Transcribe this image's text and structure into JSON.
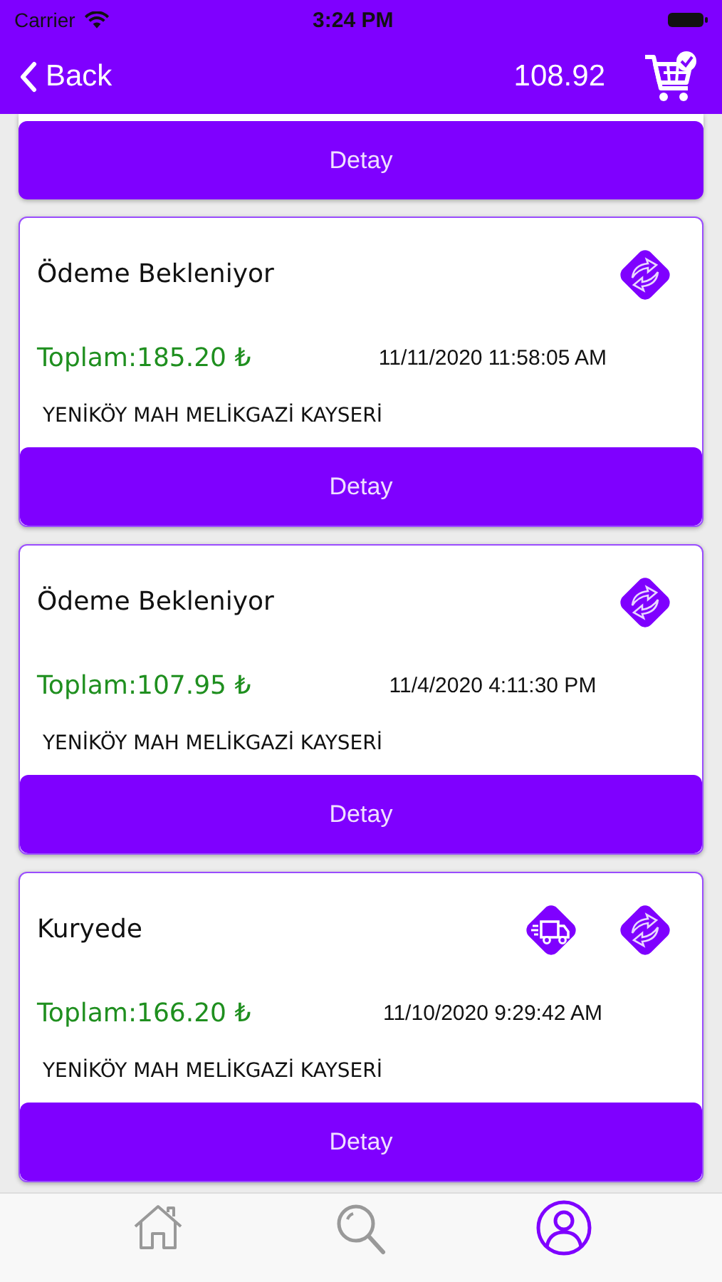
{
  "status_bar": {
    "carrier": "Carrier",
    "time": "3:24 PM"
  },
  "nav": {
    "back": "Back",
    "balance": "108.92"
  },
  "partial_order": {
    "button": "Detay"
  },
  "orders": [
    {
      "status": "Ödeme Bekleniyor",
      "icons": [
        {
          "kind": "exchange"
        }
      ],
      "total": "Toplam:185.20 ₺",
      "date": "11/11/2020 11:58:05 AM",
      "address": "YENİKÖY MAH MELİKGAZİ KAYSERİ",
      "button": "Detay"
    },
    {
      "status": "Ödeme Bekleniyor",
      "icons": [
        {
          "kind": "exchange"
        }
      ],
      "total": "Toplam:107.95 ₺",
      "date": "11/4/2020 4:11:30 PM",
      "address": "YENİKÖY MAH MELİKGAZİ KAYSERİ",
      "button": "Detay"
    },
    {
      "status": "Kuryede",
      "icons": [
        {
          "kind": "truck"
        },
        {
          "kind": "exchange"
        }
      ],
      "total": "Toplam:166.20 ₺",
      "date": "11/10/2020 9:29:42 AM",
      "address": "YENİKÖY MAH MELİKGAZİ KAYSERİ",
      "button": "Detay"
    }
  ],
  "tab_bar": [
    {
      "kind": "home",
      "selected": false
    },
    {
      "kind": "search",
      "selected": false
    },
    {
      "kind": "profile",
      "selected": true
    }
  ]
}
